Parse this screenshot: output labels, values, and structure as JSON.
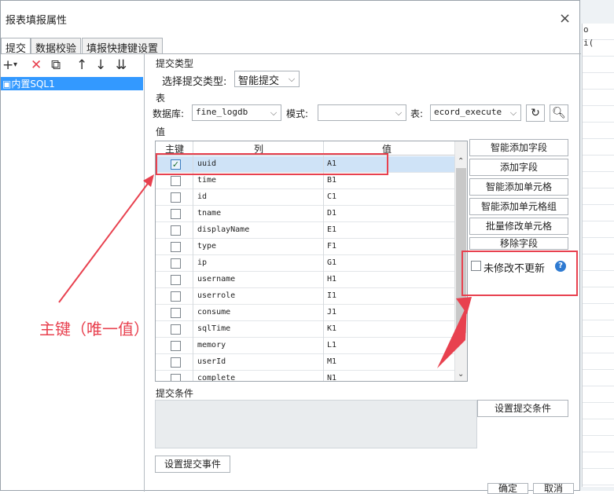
{
  "dialog": {
    "title": "报表填报属性",
    "close": "×"
  },
  "tabs": [
    "提交",
    "数据校验",
    "填报快捷键设置"
  ],
  "toolbar": {
    "add": "+",
    "add_caret": "▾",
    "delete": "✕",
    "copy": "⧉",
    "up": "↑",
    "down": "↓",
    "bottom": "⇊"
  },
  "tree": {
    "item": "内置SQL1"
  },
  "submit_type": {
    "group": "提交类型",
    "label": "选择提交类型:",
    "value": "智能提交"
  },
  "table_section": {
    "group": "表",
    "db_label": "数据库:",
    "db_value": "fine_logdb",
    "schema_label": "模式:",
    "schema_value": "",
    "table_label": "表:",
    "table_value": "ecord_execute"
  },
  "values_section": {
    "group": "值",
    "headers": [
      "主键",
      "列",
      "值"
    ],
    "rows": [
      {
        "key": true,
        "col": "uuid",
        "val": "A1"
      },
      {
        "key": false,
        "col": "time",
        "val": "B1"
      },
      {
        "key": false,
        "col": "id",
        "val": "C1"
      },
      {
        "key": false,
        "col": "tname",
        "val": "D1"
      },
      {
        "key": false,
        "col": "displayName",
        "val": "E1"
      },
      {
        "key": false,
        "col": "type",
        "val": "F1"
      },
      {
        "key": false,
        "col": "ip",
        "val": "G1"
      },
      {
        "key": false,
        "col": "username",
        "val": "H1"
      },
      {
        "key": false,
        "col": "userrole",
        "val": "I1"
      },
      {
        "key": false,
        "col": "consume",
        "val": "J1"
      },
      {
        "key": false,
        "col": "sqlTime",
        "val": "K1"
      },
      {
        "key": false,
        "col": "memory",
        "val": "L1"
      },
      {
        "key": false,
        "col": "userId",
        "val": "M1"
      },
      {
        "key": false,
        "col": "complete",
        "val": "N1"
      }
    ]
  },
  "side_buttons": [
    "智能添加字段",
    "添加字段",
    "智能添加单元格",
    "智能添加单元格组",
    "批量修改单元格",
    "移除字段"
  ],
  "no_update_unmodified": {
    "label": "未修改不更新",
    "checked": false,
    "help": "?"
  },
  "condition": {
    "group": "提交条件",
    "button": "设置提交条件"
  },
  "event_button": "设置提交事件",
  "footer": {
    "ok": "确定",
    "cancel": "取消"
  },
  "annotation": {
    "text": "主键（唯一值）",
    "color": "#e8414f"
  },
  "background": {
    "col_letter": "o",
    "col_snippet": "i("
  }
}
